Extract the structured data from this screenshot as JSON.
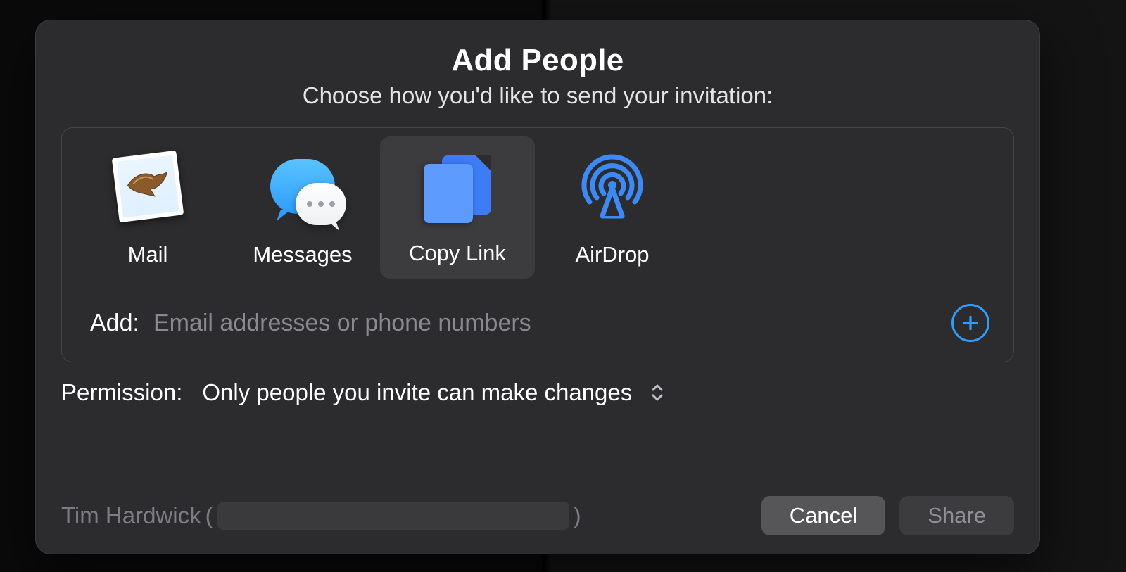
{
  "dialog": {
    "title": "Add People",
    "subtitle": "Choose how you'd like to send your invitation:"
  },
  "methods": [
    {
      "id": "mail",
      "label": "Mail",
      "icon": "mail-stamp-icon",
      "selected": false
    },
    {
      "id": "messages",
      "label": "Messages",
      "icon": "messages-icon",
      "selected": false
    },
    {
      "id": "copy-link",
      "label": "Copy Link",
      "icon": "copy-link-icon",
      "selected": true
    },
    {
      "id": "airdrop",
      "label": "AirDrop",
      "icon": "airdrop-icon",
      "selected": false
    }
  ],
  "add_field": {
    "label": "Add:",
    "placeholder": "Email addresses or phone numbers",
    "value": ""
  },
  "permission": {
    "label": "Permission:",
    "value": "Only people you invite can make changes"
  },
  "user": {
    "name": "Tim Hardwick",
    "detail_prefix": "(",
    "detail_suffix": ")"
  },
  "buttons": {
    "cancel": "Cancel",
    "share": "Share"
  },
  "colors": {
    "accent_blue": "#2f9dff",
    "sheet_bg": "#2c2c2e"
  }
}
